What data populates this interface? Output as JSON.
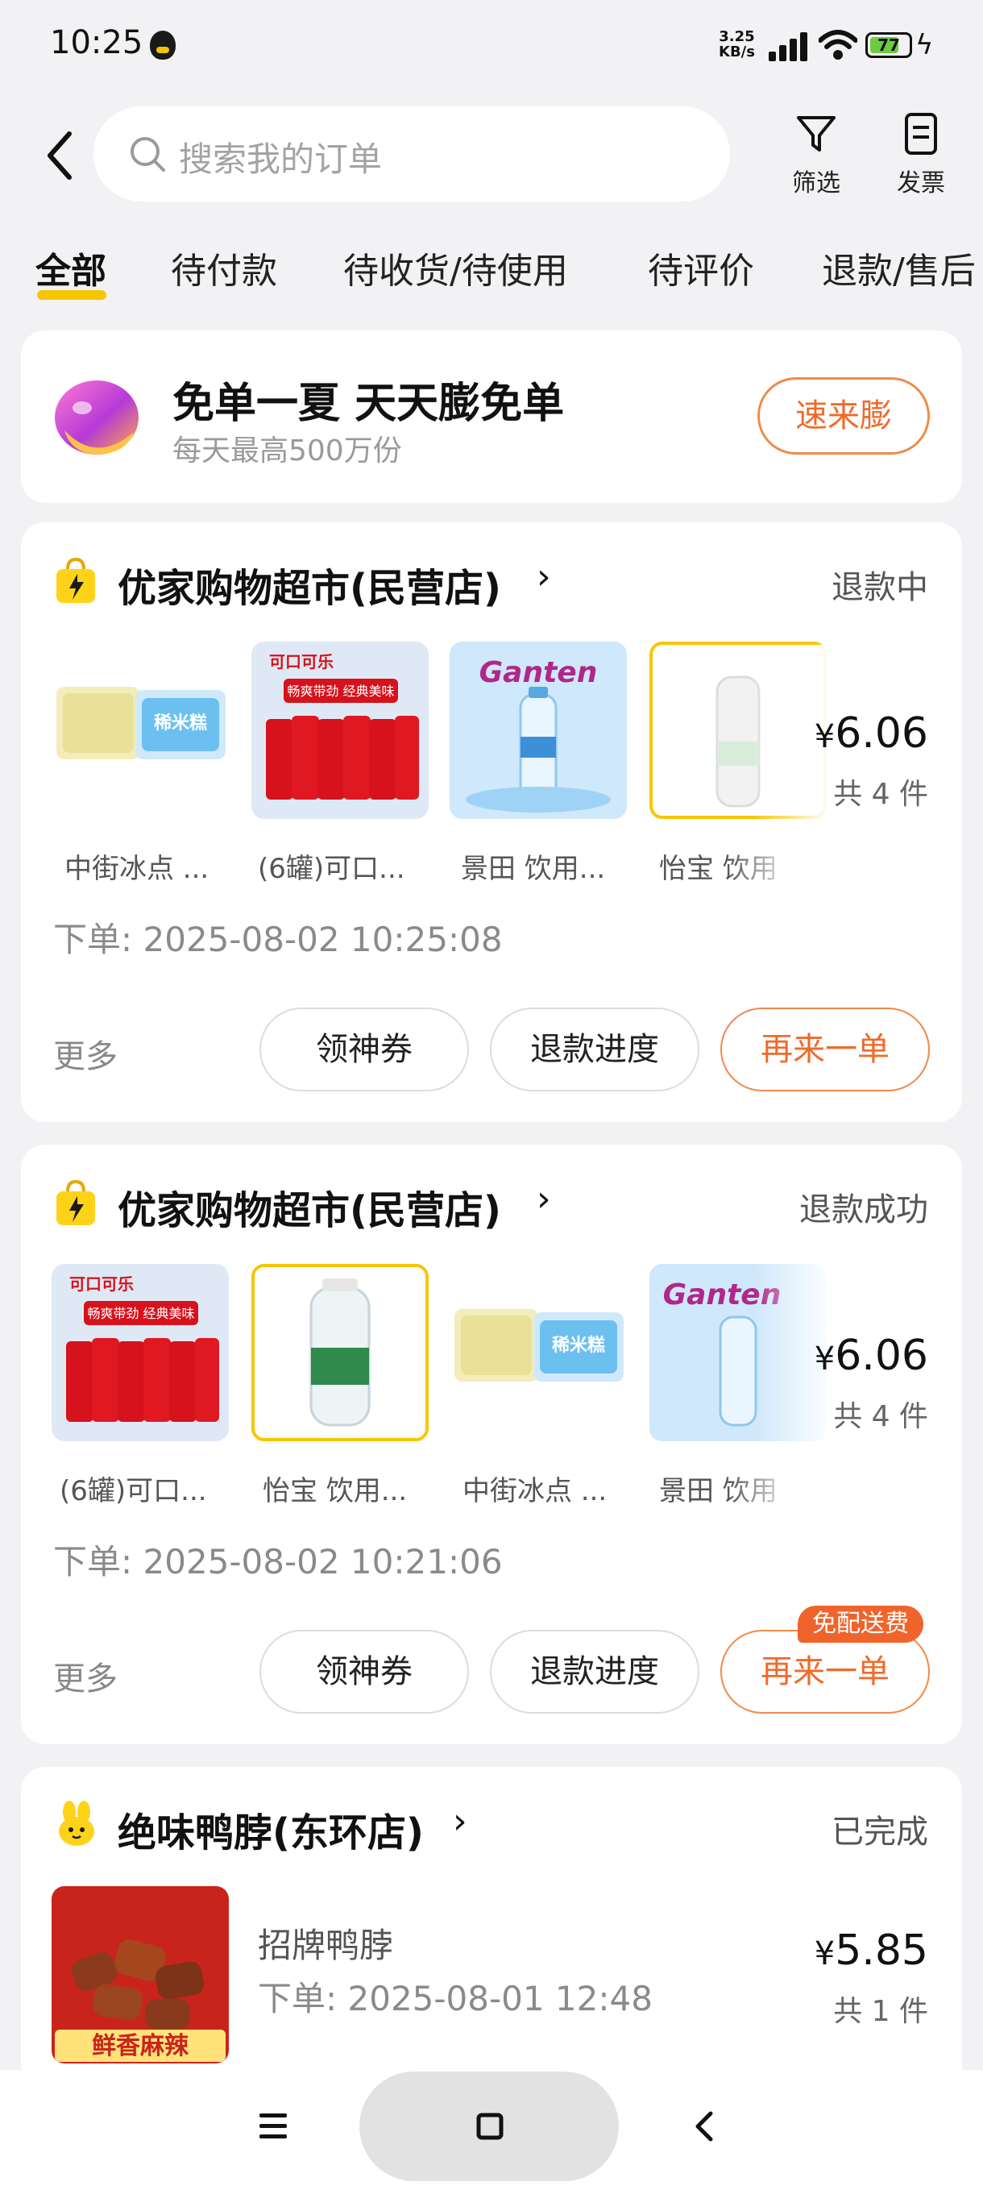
{
  "status_bar": {
    "time": "10:25",
    "net_speed_top": "3.25",
    "net_speed_bottom": "KB/s",
    "battery": "77",
    "battery_fraction": 0.77
  },
  "search": {
    "placeholder": "搜索我的订单"
  },
  "tools": {
    "filter": "筛选",
    "invoice": "发票"
  },
  "tabs": [
    "全部",
    "待付款",
    "待收货/待使用",
    "待评价",
    "退款/售后"
  ],
  "promo": {
    "title": "免单一夏 天天膨免单",
    "subtitle": "每天最高500万份",
    "button": "速来膨"
  },
  "orders": [
    {
      "store": "优家购物超市(民营店)",
      "status": "退款中",
      "items": [
        "中街冰点 ...",
        "(6罐)可口...",
        "景田 饮用...",
        "怡宝 饮用"
      ],
      "price_symbol": "¥",
      "price": "6.06",
      "count": "共 4 件",
      "time": "下单: 2025-08-02 10:25:08",
      "more": "更多",
      "buttons": [
        "领神券",
        "退款进度",
        "再来一单"
      ]
    },
    {
      "store": "优家购物超市(民营店)",
      "status": "退款成功",
      "items": [
        "(6罐)可口...",
        "怡宝 饮用...",
        "中街冰点 ...",
        "景田 饮用"
      ],
      "price_symbol": "¥",
      "price": "6.06",
      "count": "共 4 件",
      "time": "下单: 2025-08-02 10:21:06",
      "more": "更多",
      "buttons": [
        "领神券",
        "退款进度",
        "再来一单"
      ],
      "badge": "免配送费"
    },
    {
      "store": "绝味鸭脖(东环店)",
      "status": "已完成",
      "item_name": "招牌鸭脖",
      "item_image_text": "鲜香麻辣",
      "price_symbol": "¥",
      "price": "5.85",
      "count": "共 1 件",
      "time": "下单: 2025-08-01 12:48"
    }
  ],
  "product_text": {
    "cola_brand": "可口可乐",
    "cola_slogan": "畅爽带劲 经典美味",
    "water_brand": "Ganten",
    "ice_brand": "稀米糕"
  },
  "colors": {
    "accent_orange": "#f06a2a",
    "tab_underline": "#f7c600",
    "badge_bg": "#f0642c",
    "background": "#f2f2f4"
  }
}
